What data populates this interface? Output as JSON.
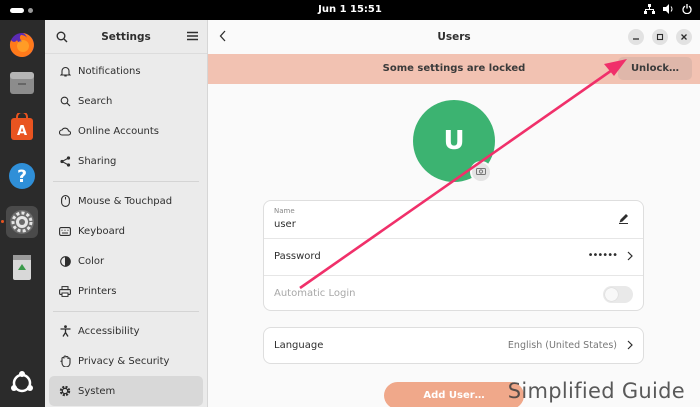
{
  "topbar": {
    "clock": "Jun 1  15:51"
  },
  "dock": {
    "apps": [
      {
        "name": "firefox-icon"
      },
      {
        "name": "files-icon"
      },
      {
        "name": "app-center-icon"
      },
      {
        "name": "help-icon"
      },
      {
        "name": "settings-icon"
      },
      {
        "name": "trash-icon"
      },
      {
        "name": "show-apps-icon"
      }
    ]
  },
  "sidebar": {
    "title": "Settings",
    "groups": [
      [
        "Notifications",
        "Search",
        "Online Accounts",
        "Sharing"
      ],
      [
        "Mouse & Touchpad",
        "Keyboard",
        "Color",
        "Printers"
      ],
      [
        "Accessibility",
        "Privacy & Security",
        "System"
      ]
    ],
    "selected": "System"
  },
  "content": {
    "title": "Users",
    "banner": {
      "message": "Some settings are locked",
      "unlock_label": "Unlock…"
    },
    "avatar": {
      "initial": "U",
      "color": "#3cb371"
    },
    "account": {
      "name_caption": "Name",
      "name_value": "user",
      "password_label": "Password",
      "password_value": "••••••",
      "autologin_label": "Automatic Login"
    },
    "language": {
      "label": "Language",
      "value": "English (United States)"
    },
    "add_user_label": "Add User…"
  },
  "watermark": "Simplified Guide",
  "colors": {
    "accent": "#e95420",
    "banner": "#f2c2b2",
    "annotation_arrow": "#f0306a"
  }
}
